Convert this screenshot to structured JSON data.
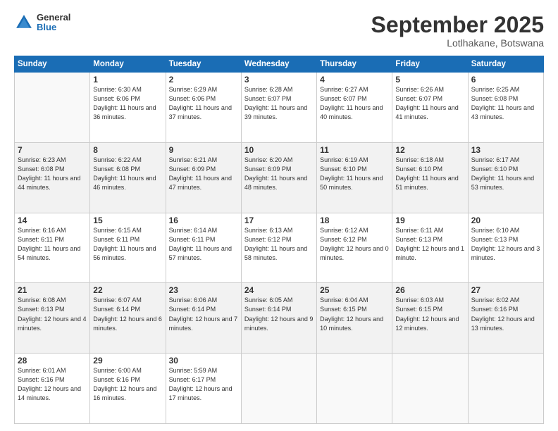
{
  "header": {
    "logo": {
      "general": "General",
      "blue": "Blue"
    },
    "title": "September 2025",
    "location": "Lotlhakane, Botswana"
  },
  "weekdays": [
    "Sunday",
    "Monday",
    "Tuesday",
    "Wednesday",
    "Thursday",
    "Friday",
    "Saturday"
  ],
  "weeks": [
    [
      {
        "day": null
      },
      {
        "day": 1,
        "sunrise": "6:30 AM",
        "sunset": "6:06 PM",
        "daylight": "11 hours and 36 minutes."
      },
      {
        "day": 2,
        "sunrise": "6:29 AM",
        "sunset": "6:06 PM",
        "daylight": "11 hours and 37 minutes."
      },
      {
        "day": 3,
        "sunrise": "6:28 AM",
        "sunset": "6:07 PM",
        "daylight": "11 hours and 39 minutes."
      },
      {
        "day": 4,
        "sunrise": "6:27 AM",
        "sunset": "6:07 PM",
        "daylight": "11 hours and 40 minutes."
      },
      {
        "day": 5,
        "sunrise": "6:26 AM",
        "sunset": "6:07 PM",
        "daylight": "11 hours and 41 minutes."
      },
      {
        "day": 6,
        "sunrise": "6:25 AM",
        "sunset": "6:08 PM",
        "daylight": "11 hours and 43 minutes."
      }
    ],
    [
      {
        "day": 7,
        "sunrise": "6:23 AM",
        "sunset": "6:08 PM",
        "daylight": "11 hours and 44 minutes."
      },
      {
        "day": 8,
        "sunrise": "6:22 AM",
        "sunset": "6:08 PM",
        "daylight": "11 hours and 46 minutes."
      },
      {
        "day": 9,
        "sunrise": "6:21 AM",
        "sunset": "6:09 PM",
        "daylight": "11 hours and 47 minutes."
      },
      {
        "day": 10,
        "sunrise": "6:20 AM",
        "sunset": "6:09 PM",
        "daylight": "11 hours and 48 minutes."
      },
      {
        "day": 11,
        "sunrise": "6:19 AM",
        "sunset": "6:10 PM",
        "daylight": "11 hours and 50 minutes."
      },
      {
        "day": 12,
        "sunrise": "6:18 AM",
        "sunset": "6:10 PM",
        "daylight": "11 hours and 51 minutes."
      },
      {
        "day": 13,
        "sunrise": "6:17 AM",
        "sunset": "6:10 PM",
        "daylight": "11 hours and 53 minutes."
      }
    ],
    [
      {
        "day": 14,
        "sunrise": "6:16 AM",
        "sunset": "6:11 PM",
        "daylight": "11 hours and 54 minutes."
      },
      {
        "day": 15,
        "sunrise": "6:15 AM",
        "sunset": "6:11 PM",
        "daylight": "11 hours and 56 minutes."
      },
      {
        "day": 16,
        "sunrise": "6:14 AM",
        "sunset": "6:11 PM",
        "daylight": "11 hours and 57 minutes."
      },
      {
        "day": 17,
        "sunrise": "6:13 AM",
        "sunset": "6:12 PM",
        "daylight": "11 hours and 58 minutes."
      },
      {
        "day": 18,
        "sunrise": "6:12 AM",
        "sunset": "6:12 PM",
        "daylight": "12 hours and 0 minutes."
      },
      {
        "day": 19,
        "sunrise": "6:11 AM",
        "sunset": "6:13 PM",
        "daylight": "12 hours and 1 minute."
      },
      {
        "day": 20,
        "sunrise": "6:10 AM",
        "sunset": "6:13 PM",
        "daylight": "12 hours and 3 minutes."
      }
    ],
    [
      {
        "day": 21,
        "sunrise": "6:08 AM",
        "sunset": "6:13 PM",
        "daylight": "12 hours and 4 minutes."
      },
      {
        "day": 22,
        "sunrise": "6:07 AM",
        "sunset": "6:14 PM",
        "daylight": "12 hours and 6 minutes."
      },
      {
        "day": 23,
        "sunrise": "6:06 AM",
        "sunset": "6:14 PM",
        "daylight": "12 hours and 7 minutes."
      },
      {
        "day": 24,
        "sunrise": "6:05 AM",
        "sunset": "6:14 PM",
        "daylight": "12 hours and 9 minutes."
      },
      {
        "day": 25,
        "sunrise": "6:04 AM",
        "sunset": "6:15 PM",
        "daylight": "12 hours and 10 minutes."
      },
      {
        "day": 26,
        "sunrise": "6:03 AM",
        "sunset": "6:15 PM",
        "daylight": "12 hours and 12 minutes."
      },
      {
        "day": 27,
        "sunrise": "6:02 AM",
        "sunset": "6:16 PM",
        "daylight": "12 hours and 13 minutes."
      }
    ],
    [
      {
        "day": 28,
        "sunrise": "6:01 AM",
        "sunset": "6:16 PM",
        "daylight": "12 hours and 14 minutes."
      },
      {
        "day": 29,
        "sunrise": "6:00 AM",
        "sunset": "6:16 PM",
        "daylight": "12 hours and 16 minutes."
      },
      {
        "day": 30,
        "sunrise": "5:59 AM",
        "sunset": "6:17 PM",
        "daylight": "12 hours and 17 minutes."
      },
      {
        "day": null
      },
      {
        "day": null
      },
      {
        "day": null
      },
      {
        "day": null
      }
    ]
  ]
}
